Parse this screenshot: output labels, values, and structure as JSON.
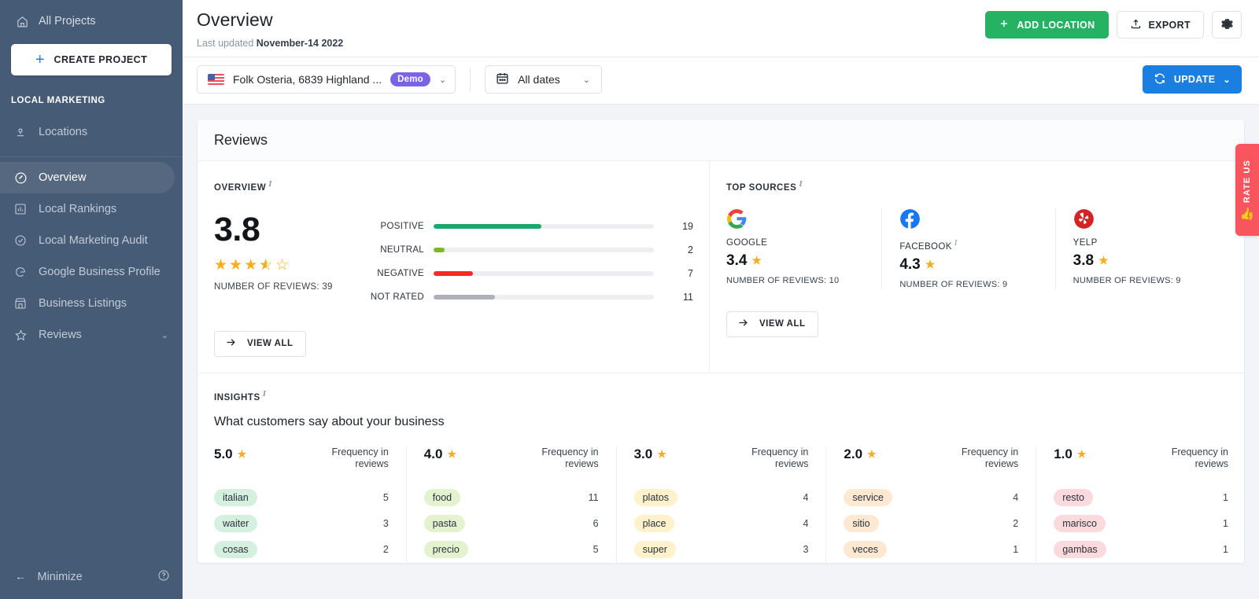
{
  "sidebar": {
    "all_projects": "All Projects",
    "create_project": "CREATE PROJECT",
    "section_label": "LOCAL MARKETING",
    "items": [
      {
        "label": "Locations",
        "icon": "location-pin-icon"
      },
      {
        "label": "Overview",
        "icon": "compass-icon"
      },
      {
        "label": "Local Rankings",
        "icon": "bar-chart-icon"
      },
      {
        "label": "Local Marketing Audit",
        "icon": "check-circle-icon"
      },
      {
        "label": "Google Business Profile",
        "icon": "google-g-icon"
      },
      {
        "label": "Business Listings",
        "icon": "storefront-icon"
      },
      {
        "label": "Reviews",
        "icon": "star-icon"
      }
    ],
    "minimize": "Minimize"
  },
  "header": {
    "title": "Overview",
    "last_updated_label": "Last updated",
    "last_updated_value": "November-14 2022",
    "add_location": "ADD LOCATION",
    "export": "EXPORT",
    "settings_icon": "gear-icon"
  },
  "filters": {
    "location": "Folk Osteria, 6839 Highland ...",
    "location_badge": "Demo",
    "date_range": "All dates",
    "update": "UPDATE"
  },
  "reviews_card": {
    "title": "Reviews",
    "overview_label": "OVERVIEW",
    "top_sources_label": "TOP SOURCES",
    "view_all": "VIEW ALL",
    "score": "3.8",
    "stars_filled": 3,
    "stars_half": 1,
    "stars_empty": 1,
    "number_of_reviews": "NUMBER OF REVIEWS: 39"
  },
  "chart_data": {
    "type": "bar",
    "title": "Reviews Overview — sentiment breakdown",
    "orientation": "horizontal",
    "categories": [
      "POSITIVE",
      "NEUTRAL",
      "NEGATIVE",
      "NOT RATED"
    ],
    "values": [
      19,
      2,
      7,
      11
    ],
    "percent_of_track": [
      49,
      5,
      18,
      28
    ],
    "colors": [
      "#1aa96a",
      "#7cb928",
      "#f72c20",
      "#acb1ba"
    ],
    "total": 39,
    "average_rating": 3.8,
    "xlabel": "",
    "ylabel": "",
    "grid": false,
    "legend": "none"
  },
  "top_sources": [
    {
      "name": "GOOGLE",
      "icon": "google-g-icon",
      "has_info": false,
      "score": "3.4",
      "reviews": "NUMBER OF REVIEWS: 10"
    },
    {
      "name": "FACEBOOK",
      "icon": "facebook-icon",
      "has_info": true,
      "score": "4.3",
      "reviews": "NUMBER OF REVIEWS: 9"
    },
    {
      "name": "YELP",
      "icon": "yelp-icon",
      "has_info": false,
      "score": "3.8",
      "reviews": "NUMBER OF REVIEWS: 9"
    }
  ],
  "insights": {
    "label": "INSIGHTS",
    "subtitle": "What customers say about your business",
    "freq_header": "Frequency in reviews",
    "columns": [
      {
        "rating": "5.0",
        "chip_color": "#d6f0e0",
        "keywords": [
          {
            "word": "italian",
            "count": "5"
          },
          {
            "word": "waiter",
            "count": "3"
          },
          {
            "word": "cosas",
            "count": "2"
          }
        ]
      },
      {
        "rating": "4.0",
        "chip_color": "#e4f2cf",
        "keywords": [
          {
            "word": "food",
            "count": "11"
          },
          {
            "word": "pasta",
            "count": "6"
          },
          {
            "word": "precio",
            "count": "5"
          }
        ]
      },
      {
        "rating": "3.0",
        "chip_color": "#fdf2cc",
        "keywords": [
          {
            "word": "platos",
            "count": "4"
          },
          {
            "word": "place",
            "count": "4"
          },
          {
            "word": "super",
            "count": "3"
          }
        ]
      },
      {
        "rating": "2.0",
        "chip_color": "#fde8d2",
        "keywords": [
          {
            "word": "service",
            "count": "4"
          },
          {
            "word": "sitio",
            "count": "2"
          },
          {
            "word": "veces",
            "count": "1"
          }
        ]
      },
      {
        "rating": "1.0",
        "chip_color": "#fadadd",
        "keywords": [
          {
            "word": "resto",
            "count": "1"
          },
          {
            "word": "marisco",
            "count": "1"
          },
          {
            "word": "gambas",
            "count": "1"
          }
        ]
      }
    ]
  },
  "rate_us": {
    "label": "RATE US",
    "icon": "thumbs-up-icon"
  },
  "colors": {
    "sidebar_bg": "#465b75",
    "accent_green": "#25b262",
    "accent_blue": "#1a7fe0",
    "badge_purple": "#7b63e8",
    "star_gold": "#f9ad19",
    "rate_us_red": "#f9555f"
  }
}
